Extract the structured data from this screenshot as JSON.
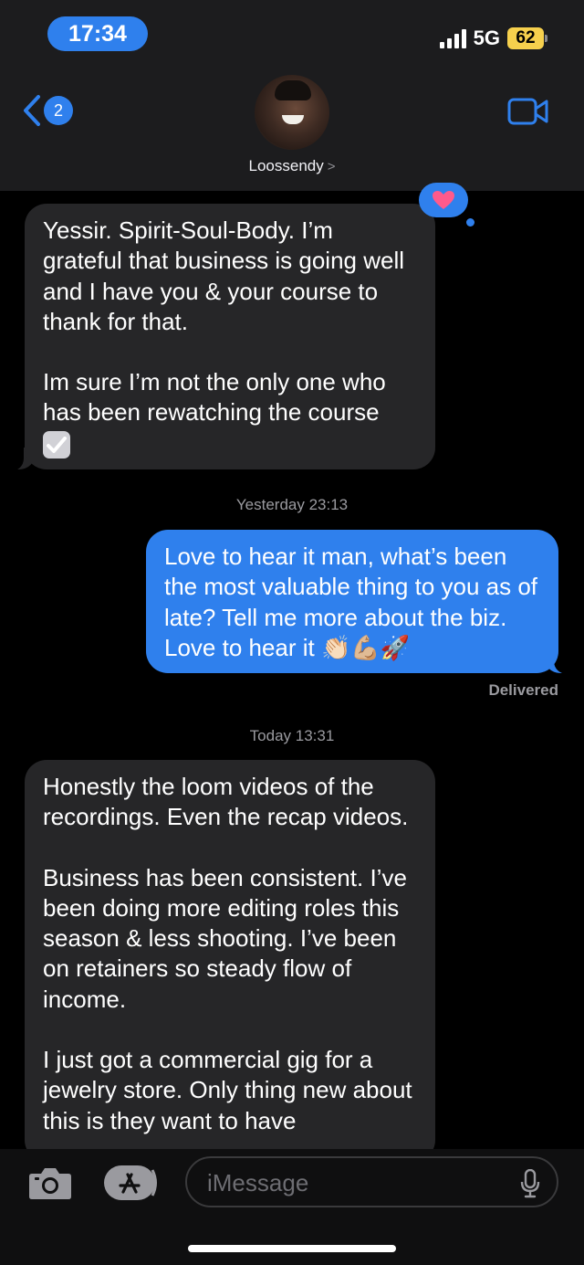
{
  "status_bar": {
    "time": "17:34",
    "network": "5G",
    "battery": "62"
  },
  "header": {
    "back_count": "2",
    "contact_name": "Loossendy",
    "contact_chevron": ">"
  },
  "thread": {
    "messages": [
      {
        "direction": "incoming",
        "paragraphs": [
          "Yessir. Spirit-Soul-Body. I’m grateful that business is going well and I have you & your course to thank for that.",
          "Im sure I’m not the only one who has been rewatching the course"
        ],
        "trailing_emoji": "check-mark-button",
        "tapback": "heart"
      },
      {
        "direction": "outgoing",
        "text": "Love to hear it man, what’s been the most valuable thing to you as of late? Tell me more about the biz. Love to hear it 👏🏻💪🏼🚀",
        "status": "Delivered"
      },
      {
        "direction": "incoming",
        "paragraphs": [
          "Honestly the loom videos of the recordings. Even the recap videos.",
          "Business has been consistent. I’ve been doing more editing roles this season & less shooting. I’ve been on retainers so steady flow of income.",
          "I just got a commercial gig for a jewelry store. Only thing new about this is they want to have"
        ]
      }
    ],
    "timestamps": {
      "yesterday": "Yesterday 23:13",
      "today": "Today 13:31"
    }
  },
  "composer": {
    "placeholder": "iMessage"
  },
  "colors": {
    "accent": "#2f80ed",
    "incoming_bubble": "#262628",
    "background": "#000000",
    "header_bg": "#1c1c1e",
    "battery": "#f6d04d"
  },
  "icons": [
    "back-chevron-icon",
    "video-camera-icon",
    "camera-icon",
    "app-store-icon",
    "microphone-icon",
    "heart-icon",
    "check-mark-icon"
  ]
}
